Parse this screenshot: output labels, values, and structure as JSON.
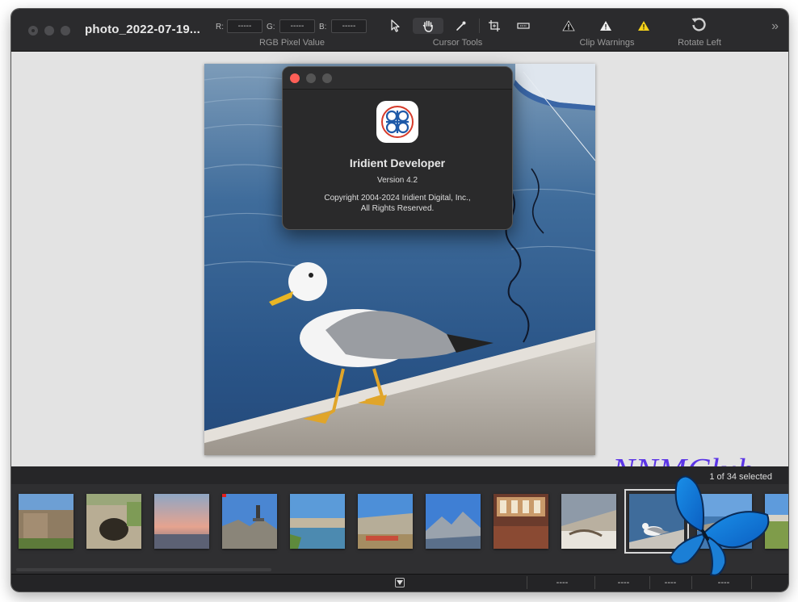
{
  "window": {
    "title": "photo_2022-07-19..."
  },
  "toolbar": {
    "rgb": {
      "r_label": "R:",
      "r_value": "-----",
      "g_label": "G:",
      "g_value": "-----",
      "b_label": "B:",
      "b_value": "-----",
      "group_label": "RGB Pixel Value"
    },
    "cursor_tools": {
      "group_label": "Cursor Tools",
      "tools": [
        "pointer-icon",
        "hand-icon",
        "eyedropper-icon",
        "crop-icon",
        "straighten-icon"
      ],
      "active": "hand-icon"
    },
    "clip_warnings": {
      "group_label": "Clip Warnings",
      "icons": [
        "shadow-warning-icon",
        "highlight-warning-icon",
        "color-warning-icon"
      ]
    },
    "rotate": {
      "label": "Rotate Left",
      "icon": "rotate-left-icon"
    },
    "overflow_icon": "chevron-double-right-icon"
  },
  "about_dialog": {
    "app_name": "Iridient Developer",
    "version": "Version 4.2",
    "copyright_line1": "Copyright 2004-2024 Iridient Digital, Inc.,",
    "copyright_line2": "All Rights Reserved."
  },
  "watermark": {
    "text": "NNMClub",
    "color": "#5b35e6"
  },
  "filmstrip": {
    "selection_status": "1 of 34 selected",
    "thumbnails": [
      {
        "subject": "stone wall"
      },
      {
        "subject": "cave"
      },
      {
        "subject": "sunset sea"
      },
      {
        "subject": "cliff with tower",
        "flagged": true
      },
      {
        "subject": "lake cliffs"
      },
      {
        "subject": "cliff village"
      },
      {
        "subject": "mountain"
      },
      {
        "subject": "interior hall"
      },
      {
        "subject": "rocky coast"
      },
      {
        "subject": "seagull",
        "selected": true
      },
      {
        "subject": "sea view"
      },
      {
        "subject": "coast"
      }
    ]
  },
  "statusbar": {
    "fields": [
      "----",
      "----",
      "----",
      "----"
    ]
  },
  "colors": {
    "toolbar_bg": "#2b2b2d",
    "canvas_bg": "#e3e3e3",
    "close_red": "#fe5f57",
    "warning_yellow": "#f5d21a"
  }
}
